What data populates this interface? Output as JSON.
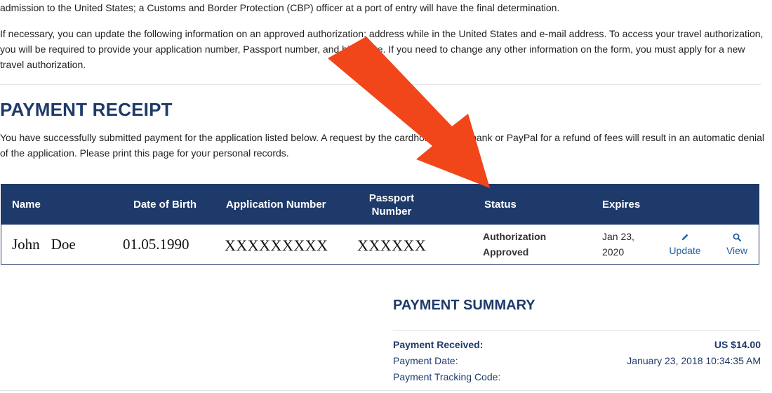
{
  "intro": {
    "paragraph1": "admission to the United States; a Customs and Border Protection (CBP) officer at a port of entry will have the final determination.",
    "paragraph2": "If necessary, you can update the following information on an approved authorization: address while in the United States and e-mail address. To access your travel authorization, you will be required to provide your application number, Passport number, and birth date. If you need to change any other information on the form, you must apply for a new travel authorization."
  },
  "receipt": {
    "title": "PAYMENT RECEIPT",
    "description": "You have successfully submitted payment for the application listed below. A request by the cardholder to the bank or PayPal for a refund of fees will result in an automatic denial of the application. Please print this page for your personal records."
  },
  "table": {
    "headers": {
      "name": "Name",
      "dob": "Date of Birth",
      "application_number": "Application Number",
      "passport_line1": "Passport",
      "passport_line2": "Number",
      "status": "Status",
      "expires": "Expires"
    },
    "rows": [
      {
        "first_name": "John",
        "last_name": "Doe",
        "dob": "01.05.1990",
        "application_number": "XXXXXXXXX",
        "passport_number": "XXXXXX",
        "status_line1": "Authorization",
        "status_line2": "Approved",
        "expires_line1": "Jan 23,",
        "expires_line2": "2020",
        "update_label": "Update",
        "view_label": "View",
        "update_icon": "pencil-icon",
        "view_icon": "search-icon"
      }
    ]
  },
  "summary": {
    "title": "PAYMENT SUMMARY",
    "payment_received_label": "Payment Received:",
    "payment_received_value": "US $14.00",
    "payment_date_label": "Payment Date:",
    "payment_date_value": "January 23, 2018 10:34:35 AM",
    "tracking_code_label": "Payment Tracking Code:",
    "tracking_code_value": ""
  },
  "colors": {
    "navy": "#1e3a6a",
    "link": "#1f5f9f",
    "arrow": "#f0461a"
  },
  "overlay": {
    "arrow_icon": "red-arrow-annotation"
  }
}
